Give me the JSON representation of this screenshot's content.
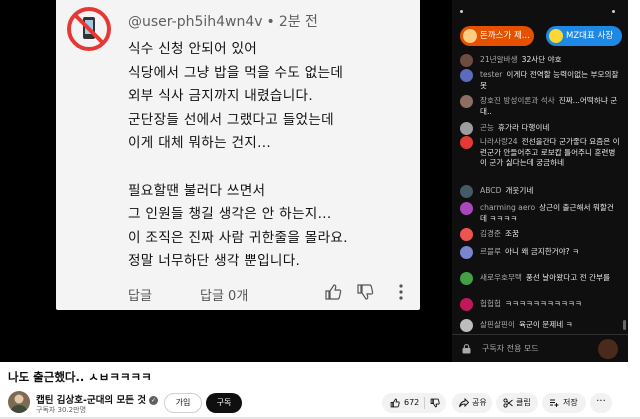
{
  "comment": {
    "author": "@user-ph5ih4wn4v",
    "separator": "•",
    "time": "2분 전",
    "lines": [
      "식수 신청 안되어 있어",
      "식당에서 그냥 밥을 먹을 수도 없는데",
      "외부 식사 금지까지 내렸습니다.",
      "군단장들 선에서 그랬다고 들었는데",
      "이게 대체 뭐하는 건지...",
      "",
      "필요할땐 불러다 쓰면서",
      "그 인원들 챙길 생각은 안 하는지...",
      "이 조직은 진짜 사람 귀한줄을 몰라요.",
      "정말 너무하단 생각 뿐입니다."
    ],
    "reply_label": "답글",
    "reply_count": "답글 0개"
  },
  "chat": {
    "donors": [
      {
        "name": "돈까스가 제...",
        "color": "#e65100"
      },
      {
        "name": "MZ대표 사장",
        "color": "#1e88e5"
      }
    ],
    "messages": [
      {
        "author": "21년알바생",
        "text": "32사단 야호",
        "avatar_color": "#6d4c41"
      },
      {
        "author": "tester",
        "text": "이게다 전역할 능력이없는 부모의잘못",
        "avatar_color": "#5c6bc0"
      },
      {
        "author": "장호진 방성이론과 석사",
        "text": "진짜...어떡하냐 군대..",
        "avatar_color": "#8d6e63"
      },
      {
        "author": "곤능",
        "text": "휴가라 다행이네",
        "avatar_color": "#9e9e9e"
      },
      {
        "author": "나라사랑24",
        "text": "전선을간다 군가좋다 요즘은 이런군가 안들어주고 로보캅 틀어주니 훈련병이 군가 싫다는데 궁금하네",
        "avatar_color": "#e53935"
      },
      {
        "author": "ABCD",
        "text": "개웃기네",
        "avatar_color": "#455a64"
      },
      {
        "author": "charming aero",
        "text": "상근이 출근해서 뭐할건데 ㅋㅋㅋㅋ",
        "avatar_color": "#ab47bc"
      },
      {
        "author": "김경준",
        "text": "조꿈",
        "avatar_color": "#ef5350"
      },
      {
        "author": "르블루",
        "text": "아니 왜 금지한거야? ㅋ",
        "avatar_color": "#7986cb"
      },
      {
        "author": "새로우호무택",
        "text": "풍선 날아왔다고 전 간부를",
        "avatar_color": "#43a047"
      },
      {
        "author": "헙헙헙",
        "text": "ㅋㅋㅋㅋㅋㅋㅋㅋㅋㅋㅋ",
        "avatar_color": "#c2185b"
      },
      {
        "author": "살핀살핀이",
        "text": "육군이 문제네 ㅋ",
        "avatar_color": "#bdbdbd"
      }
    ],
    "footer_mode": "구독자 전용 모드"
  },
  "video": {
    "title": "나도 출근했다.. ㅅㅂㅋㅋㅋㅋ",
    "channel": "캡틴 김상호-군대의 모든 것",
    "verified_mark": "✓",
    "subscribers": "구독자 30.2만명",
    "join_label": "가입",
    "subscribe_label": "구독",
    "like_count": "672",
    "share_label": "공유",
    "clip_label": "클립",
    "save_label": "저장",
    "more_label": "···"
  }
}
